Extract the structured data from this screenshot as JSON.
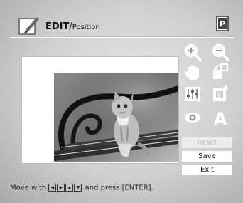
{
  "header": {
    "title_main": "EDIT",
    "title_sep": "/",
    "title_sub": "Position"
  },
  "icons": {
    "edit": "pencil-edit-icon",
    "print": "print-preview-icon"
  },
  "tools": [
    {
      "name": "zoom-in-icon"
    },
    {
      "name": "zoom-out-icon"
    },
    {
      "name": "hand-move-icon"
    },
    {
      "name": "rotate-icon"
    },
    {
      "name": "adjust-sliders-icon"
    },
    {
      "name": "frame-icon"
    },
    {
      "name": "red-eye-icon"
    },
    {
      "name": "text-icon"
    }
  ],
  "buttons": {
    "reset": "Reset",
    "save": "Save",
    "exit": "Exit"
  },
  "footer": {
    "before": "Move with",
    "after": "and press [ENTER]."
  }
}
